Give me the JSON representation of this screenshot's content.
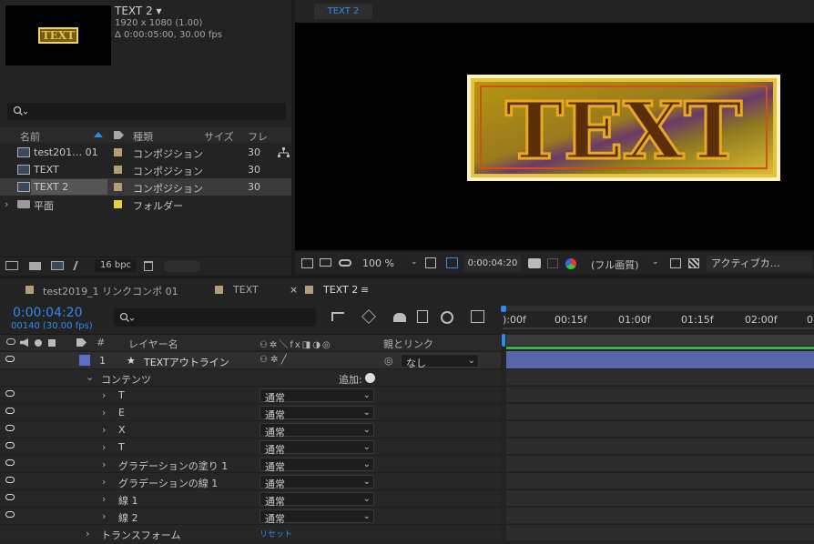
{
  "project": {
    "comp_name": "TEXT 2 ▾",
    "resolution": "1920 x 1080 (1.00)",
    "duration": "Δ 0:00:05:00, 30.00 fps",
    "thumb_text": "TEXT",
    "search_placeholder": "",
    "columns": {
      "name": "名前",
      "type": "種類",
      "size": "サイズ",
      "frame": "フレ"
    },
    "items": [
      {
        "name": "test201… 01",
        "type": "コンポジション",
        "frame": "30"
      },
      {
        "name": "TEXT",
        "type": "コンポジション",
        "frame": "30"
      },
      {
        "name": "TEXT 2",
        "type": "コンポジション",
        "frame": "30"
      },
      {
        "name": "平面",
        "type": "フォルダー",
        "frame": ""
      }
    ],
    "bpc": "16 bpc"
  },
  "viewer": {
    "tab": "TEXT 2",
    "canvas_text": "TEXT",
    "zoom": "100 %",
    "timecode": "0:00:04:20",
    "quality": "(フル画質)",
    "camera": "アクティブカ…"
  },
  "timeline": {
    "tabs": [
      {
        "label": "test2019_1 リンクコンポ 01",
        "color": "#b39e76"
      },
      {
        "label": "TEXT",
        "color": "#b39e76"
      },
      {
        "label": "TEXT 2",
        "color": "#b39e76",
        "close": "×",
        "menu": "≡"
      }
    ],
    "current_time": "0:00:04:20",
    "frame_info": "00140 (30.00 fps)",
    "headers": {
      "hash": "#",
      "layer_name": "レイヤー名",
      "parent": "親とリンク"
    },
    "layer": {
      "index": "1",
      "name": "TEXTアウトライン",
      "parent": "なし",
      "label_color": "#5b6cc9"
    },
    "contents": {
      "label": "コンテンツ",
      "add": "追加:"
    },
    "rows": [
      {
        "name": "T",
        "mode": "通常"
      },
      {
        "name": "E",
        "mode": "通常"
      },
      {
        "name": "X",
        "mode": "通常"
      },
      {
        "name": "T",
        "mode": "通常"
      },
      {
        "name": "グラデーションの塗り 1",
        "mode": "通常"
      },
      {
        "name": "グラデーションの線 1",
        "mode": "通常"
      },
      {
        "name": "線 1",
        "mode": "通常"
      },
      {
        "name": "線 2",
        "mode": "通常"
      }
    ],
    "transform": {
      "label": "トランスフォーム",
      "reset": "リセット"
    },
    "ruler": [
      "):00f",
      "00:15f",
      "01:00f",
      "01:15f",
      "02:00f",
      "0"
    ]
  }
}
